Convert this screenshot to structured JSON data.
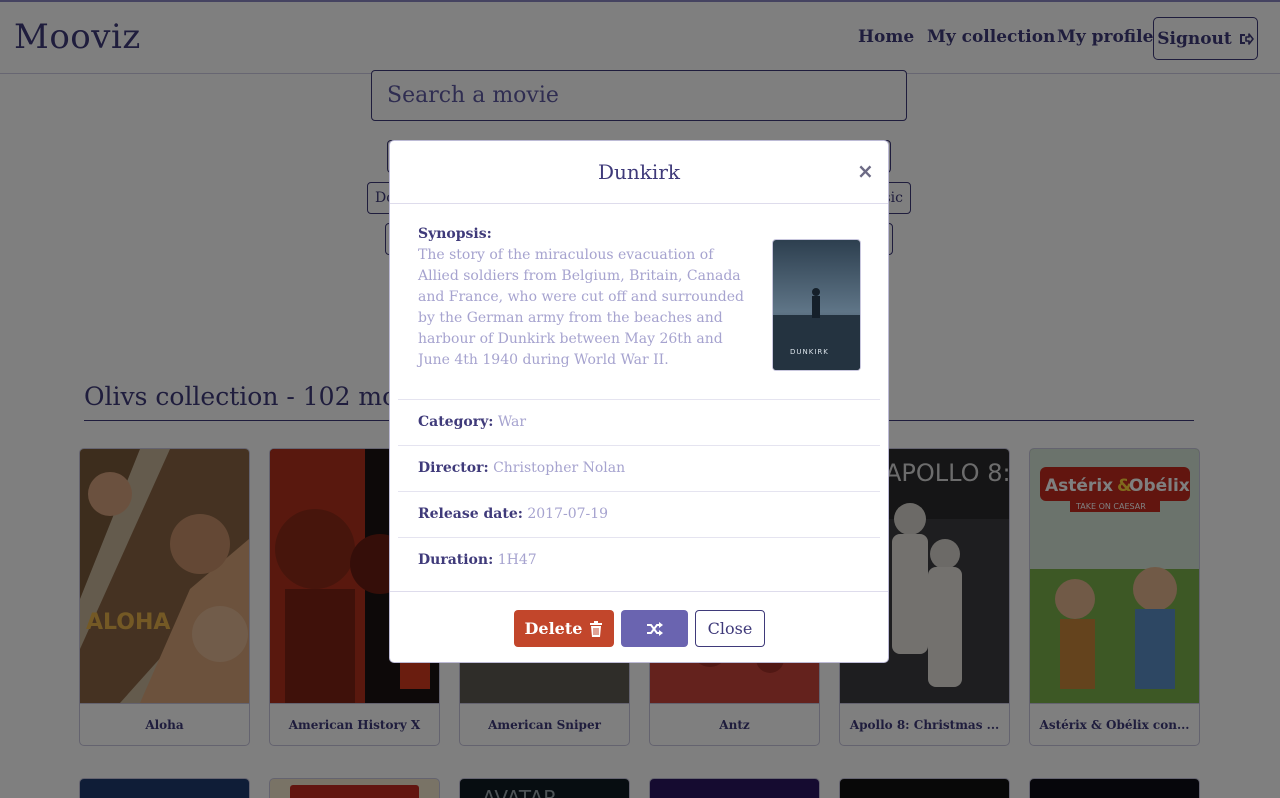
{
  "navbar": {
    "brand": "Mooviz",
    "links": [
      "Home",
      "My collection",
      "My profile"
    ],
    "signout_label": "Signout",
    "signout_icon": "sign-out-icon"
  },
  "search": {
    "placeholder": "Search a movie"
  },
  "background_buttons": [
    "Do",
    "sic"
  ],
  "collection": {
    "title": "Olivs collection - 102 mov",
    "movies": [
      {
        "title": "Aloha"
      },
      {
        "title": "American History X"
      },
      {
        "title": "American Sniper"
      },
      {
        "title": "Antz"
      },
      {
        "title": "Apollo 8: Christmas ..."
      },
      {
        "title": "Astérix & Obélix con..."
      }
    ],
    "poster_text": {
      "aloha": "ALOHA",
      "apollo": "APOLLO 8:",
      "asterix_line1": "Astérix",
      "asterix_amp": "&",
      "asterix_line2": "Obélix",
      "asterix_sub": "TAKE ON CAESAR",
      "avatar": "AVATAR"
    }
  },
  "modal": {
    "title": "Dunkirk",
    "close_x": "×",
    "synopsis_label": "Synopsis:",
    "synopsis": "The story of the miraculous evacuation of Allied soldiers from Belgium, Britain, Canada and France, who were cut off and surrounded by the German army from the beaches and harbour of Dunkirk between May 26th and June 4th 1940 during World War II.",
    "poster_caption": "DUNKIRK",
    "fields": [
      {
        "label": "Category:",
        "value": "War"
      },
      {
        "label": "Director:",
        "value": "Christopher Nolan"
      },
      {
        "label": "Release date:",
        "value": "2017-07-19"
      },
      {
        "label": "Duration:",
        "value": "1H47"
      }
    ],
    "footer": {
      "delete_label": "Delete",
      "delete_icon": "trash-icon",
      "shuffle_icon": "shuffle-icon",
      "close_label": "Close"
    }
  },
  "colors": {
    "primary": "#3f3a7a",
    "muted": "#a6a3cf",
    "delete": "#c2462b",
    "shuffle": "#6a64b0"
  }
}
